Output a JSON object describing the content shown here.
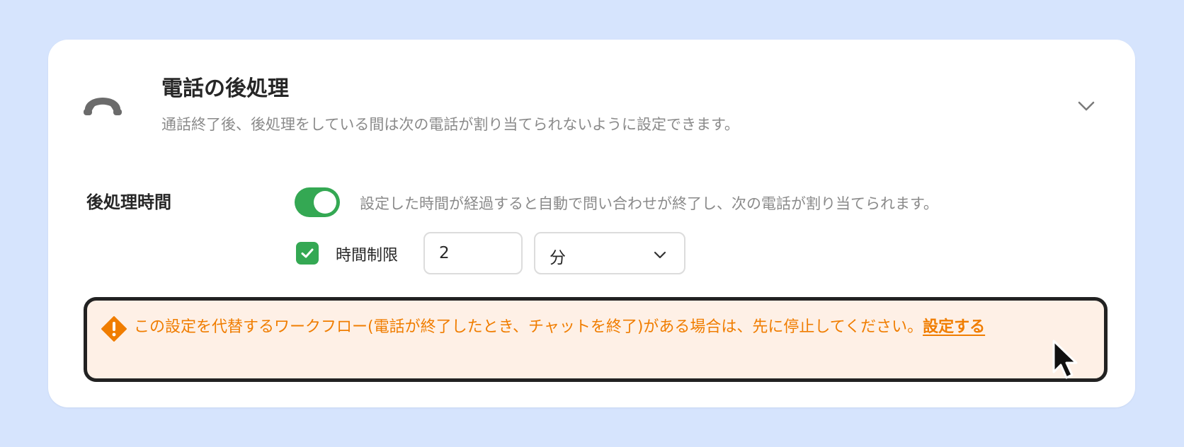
{
  "section": {
    "title": "電話の後処理",
    "description": "通話終了後、後処理をしている間は次の電話が割り当てられないように設定できます。",
    "icon": "phone-hangup-icon",
    "expand_icon": "chevron-down-icon"
  },
  "after_call_time": {
    "label": "後処理時間",
    "toggle_on": true,
    "toggle_description": "設定した時間が経過すると自動で問い合わせが終了し、次の電話が割り当てられます。",
    "time_limit_checked": true,
    "time_limit_label": "時間制限",
    "time_value": "2",
    "unit_selected": "分"
  },
  "warning": {
    "icon": "exclamation-icon",
    "text": "この設定を代替するワークフロー(電話が終了したとき、チャットを終了)がある場合は、先に停止してください。",
    "link_label": "設定する"
  },
  "colors": {
    "background": "#d6e4fd",
    "card": "#ffffff",
    "accent_green": "#34a853",
    "warning_orange": "#f07d00",
    "warning_bg": "#fef0e6"
  }
}
